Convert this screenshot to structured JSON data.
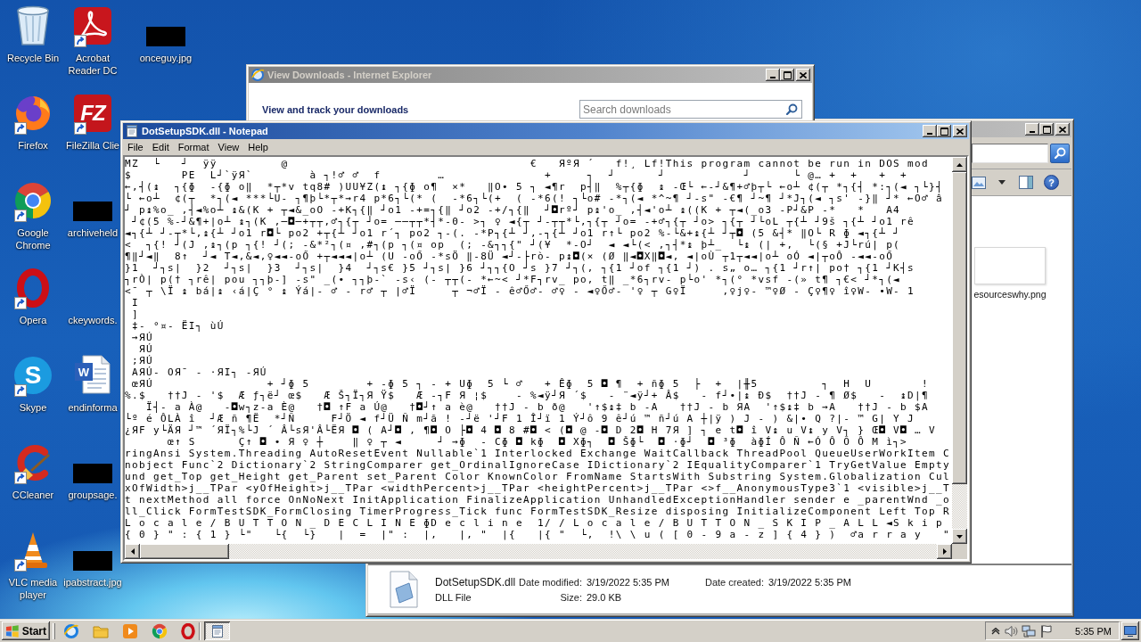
{
  "desktop_icons": [
    {
      "label": "Recycle Bin",
      "kind": "recycle-bin",
      "shortcut": false
    },
    {
      "label": "Firefox",
      "kind": "firefox",
      "shortcut": true
    },
    {
      "label": "Google Chrome",
      "kind": "chrome",
      "shortcut": true
    },
    {
      "label": "Opera",
      "kind": "opera",
      "shortcut": true
    },
    {
      "label": "Skype",
      "kind": "skype",
      "shortcut": true,
      "logo_text": "S"
    },
    {
      "label": "CCleaner",
      "kind": "ccleaner",
      "shortcut": true
    },
    {
      "label": "VLC media player",
      "kind": "vlc",
      "shortcut": true
    },
    {
      "label": "Acrobat Reader DC",
      "kind": "acrobat",
      "shortcut": true
    },
    {
      "label": "FileZilla Clie",
      "kind": "filezilla",
      "shortcut": true,
      "logo_text": "FZ"
    },
    {
      "label": "archiveheld",
      "kind": "image",
      "shortcut": false
    },
    {
      "label": "ckeywords.",
      "kind": "blank",
      "shortcut": false
    },
    {
      "label": "endinforma",
      "kind": "word-doc",
      "shortcut": false,
      "logo_text": "W"
    },
    {
      "label": "groupsage.",
      "kind": "image",
      "shortcut": false
    },
    {
      "label": "ipabstract.jpg",
      "kind": "image",
      "shortcut": false
    },
    {
      "label": "onceguy.jpg",
      "kind": "image",
      "shortcut": false
    }
  ],
  "windows": {
    "downloads": {
      "title": "View Downloads - Internet Explorer",
      "active": false,
      "heading": "View and track your downloads",
      "search": {
        "placeholder": "Search downloads"
      }
    },
    "notepad": {
      "title": "DotSetupSDK.dll - Notepad",
      "active": true,
      "menu": [
        "File",
        "Edit",
        "Format",
        "View",
        "Help"
      ],
      "lines": [
        "MZ  └   ┘  ÿÿ         @                                  €   ЯºЯ ´   f!¸ Lf!This program cannot be run in DOS mod",
        "$       PE  L┘`ÿЯ`        à ┐!♂ ♂  f        …              +     ┐  ┘      ┘           ┘      └ @… +  +   +  +",
        "←,┤(↨  ┐{ɸ  -{ɸ o‖  *┬*v tq8# )UU¥Z(↨ ┐{ɸ o¶  ×*   ‖O• 5 ┐ ◄¶r  p┤‖  %┬{ɸ  ↨ -Œ└ ←-┘&¶+♂þ┬└ ←o┴ ¢(┬ *┐{┤ *:┐(◄ ┐└}┤",
        "└ ←o┴  ¢(┬  *┐(◄ ***└U- ┐¶þ└*┬*→r4 p*6┐└(* (  -*6┐└(+  ( -*6(! ┐└o# -*┐(◄ *^~¶ ┘-s\" -€¶ ┘~¶ ┘*J┐(◄ ┐s' -}‖ ┘* ←O♂ â",
        "┘ p↨%o_ ,┤◄%o┴ ↨&(K + ┬◄&_oO -+K┐{‖ ┘o1 -+=┐{‖ ┘o2 -+/┐{‖  ┘◘rº┘ p↨'o_ ,┤◄'o┴ ↨((K + ┬◄(_o3 -P┘&P -*   *   A4",
        " ┘¢(5 %-┘&¶+|o┴ ↨┐(K ,─◘─+┬┬,♂┐{┬ ┘o= ──┬┬*┤*-0- >┐ ♀ ◄{┬ ┘-┬┬*└,┐{┬ ┘o= -+♂┐{┬ ┘o> ┐{┬ ┘└oL ┬{┴ ┘9š ┐{┴ ┘o1 rê",
        "◄┐{┴ ┘-┬*└,↨{┴ ┘o1 r◘└ po2 +┬{┴ ┘o1 r´┐ po2 ┐-(. -*P┐{┴ ┘,-┐{┴ ┘o1 r↑└ po2 %-└&+↨{┴ ┘┬◘ (5 &┤* ‖O└ R ɸ ◄┐{┴ ┘",
        "<  ┐{! ┘(J ,↨┐(p ┐{! ┘(; -&*²┐(¤ ,#┐(p ┐(¤ op  (; -&┐┐{\" ┘(¥  *-O┘  ◄ ◄└(< ,┐┤*↨ þ┴_  └↨ (| +,  └(§ +J└rú| p(",
        "¶‖┘◄‖  8↑  ┘◄ T◄,&◄,♀◄◄-oŐ +┬◄◄◄|o┴ (U -oŐ -*sÖ ‖-8Ü ◄┘-├rò- p↨◘(× (Ø ‖◄◘X‖◘◄, ◄|oÙ ┬1┬◄◄|o┴ oÓ ◄|┬oÔ -◄◄-oŐ",
        "}1  ┘┐s|  }2  ┘┐s|  }3  ┘┐s|  }4  ┘┐s€ }5 ┘┐s| }6 ┘┐┐{O ┘s }7 ┘┐(, ┐{1 ┘of ┐{1 ┘) . s„ o… ┐{1 ┘r↑| po† ┐{1 ┘K┤s",
        "┐rÒ| p(† ┐rê| pou ┐┐þ-] -s\" _(• ┐┐þ-` -s‹ (- ┬┬(- *←~< ┘*F┐rv_ po, t‖ _*6┐rv- p└o' *┐(° *vsf -(» t¶ ┐€< ┘*┐(◄",
        "<¯ ┬ \\Ï ↨ bá|↨ ‹á|Ç ° ↨ Ýá|- ♂ - r♂ ┬ |♂Ï     ┬ ¬♂Ï - ê♂Ő♂- ♂♀ - ◄♀Ő♂- '♀ ┬ G♀Ï     ,♀j♀- ™♀Ø - Ç♀¶♀ î♀W- •W- 1",
        " I",
        " ]",
        " ‡- °¤- ËI┐ ùÚ",
        " →ЯÚ",
        "  ЯÚ",
        " ;ЯÚ",
        " AЯÚ- OЯ¯ - ·ЯI┐ -ЯÚ",
        " œЯÚ                + ┘ɸ 5        + -ɸ 5 ┐ - + Uɸ  5 └ ♂   + Êɸ  5 ◘ ¶  + ñɸ 5  ├  +  |╫5         ┐  H  U       !",
        "%.$   ††J - '$  Æ ƒ┐ë┘ œ$   Æ Š┐Ï┐Я Ÿ$   Æ -┐F Я ¦$    - %◄ÿ┘Я ´$   - ¨◄ÿ┘+ Â$   - f┘•|↨ Ð$  ††J - ¶ Ø$   -  ↨D|¶",
        "   Ï┤- a À@   -◘w┐z-a È@   †◘ ↑F a Ú@   †◘┘↑ a è@   ††J - b ð@   '↑$↨‡ b -A   ††J - b ЯA  '↑$↨‡ b →A   ††J - b $A",
        "└º é ÔLÀ î  ┘Æ ñ ¶Ë  *┘Ñ     F┘Ö ◄ f┘Ü Ñ m┘ã ! -┘ë '┘F 1 Î┘ï 1 Ý┘ô 9 ê┘ú ™ ñ┘ú A ┼|ÿ ) J - ) &|• Q ?|- ™ G| Y J",
        "¿ЯF y└ÄЯ ┘™ ´ЯÏ┐%└J ´ Â└sЯ'Â└ËЯ ◘ ( A┘◘ , ¶◘ O ├◘ 4 ◘ 8 #◘ < (◘ @ -◘ D 2◘ H 7Я ] ┐ e t◘ î V↨ u V↨ y V┐ } Œ◘ V◘ … V",
        "      œ↑ S      Ç↑ ◘ • Я ♀ ┼    ‖ ♀ ┬ ◄     ┘ →ɸ  - Cɸ ◘ kɸ  ◘ Xɸ┐  ◘ Šɸ└  ◘ ·ɸ┘  ◘ ³ɸ  àɸÍ Ô Ñ ←Ó Ô Õ Ô M ì┐>",
        "ringAnsi System.Threading AutoResetEvent Nullable`1 Interlocked Exchange WaitCallback ThreadPool QueueUserWorkItem C",
        "nobject Func`2 Dictionary`2 StringComparer get_OrdinalIgnoreCase IDictionary`2 IEqualityComparer`1 TryGetValue Empty",
        "und get_Top get_Height get_Parent set_Parent Color KnownColor FromName StartsWith Substring System.Globalization Cul",
        "xOfWidth>j__TPar <yOfHeight>j__TPar <widthPercent>j__TPar <heightPercent>j__TPar <>f__AnonymousType3`1 <visible>j__T",
        "t nextMethod all force OnNoNext InitApplication FinalizeApplication UnhandledExceptionHandler sender e _parentWnd _o",
        "ll_Click FormTestSDK_FormClosing TimerProgress_Tick func FormTestSDK_Resize disposing InitializeComponent Left Top R",
        "L o c a l e / B U T T O N _ D E C L I N E ɸD e c l i n e  1/ / L o c a l e / B U T T O N _ S K I P _ A L L ◄S k i p",
        "{ 0 } \" : { 1 } └\"   └{  └}   |  =  |\" :  |,   |, \"  |{   |{ \"  └,  !\\ \\ u ( [ 0 - 9 a - z ] { 4 } )  ♂a r r a y   \""
      ]
    },
    "file_browser": {
      "active": false,
      "help_button": "?",
      "files": [
        {
          "label": "esourceswhy.png"
        }
      ],
      "details": [
        {
          "title": "DotSetupSDK.dll",
          "fields": [
            {
              "label": "Date modified:",
              "value": "3/19/2022 5:35 PM"
            },
            {
              "label": "Date created:",
              "value": "3/19/2022 5:35 PM"
            }
          ]
        },
        {
          "title": "DLL File",
          "fields": [
            {
              "label": "Size:",
              "value": "29.0 KB"
            }
          ]
        }
      ]
    }
  },
  "taskbar": {
    "start": "Start",
    "tasks": [
      {
        "selected": true
      }
    ],
    "clock": "5:35 PM"
  }
}
